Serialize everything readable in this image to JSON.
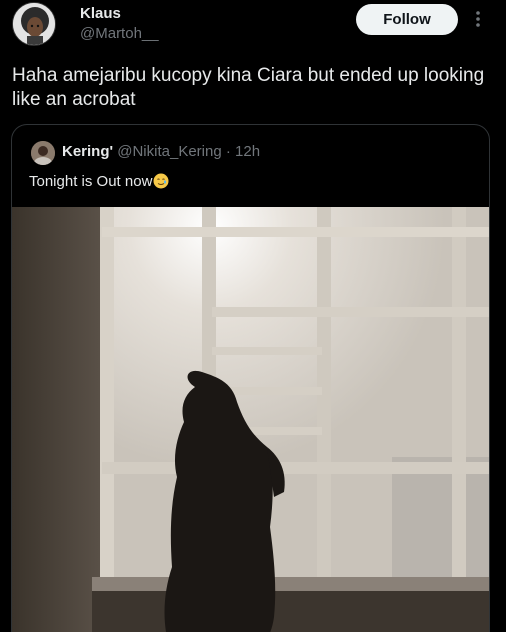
{
  "author": {
    "name": "Klaus",
    "handle": "@Martoh__"
  },
  "follow_label": "Follow",
  "tweet": {
    "text": "Haha amejaribu kucopy kina Ciara but ended up looking like an acrobat"
  },
  "quote": {
    "name": "Kering'",
    "handle": "@Nikita_Kering",
    "separator": " · ",
    "time": "12h",
    "text": "Tonight is Out now",
    "emoji": "smiling-face-with-tear"
  },
  "icons": {
    "more": "more-vertical-icon"
  },
  "colors": {
    "background": "#000000",
    "text": "#e7e9ea",
    "muted": "#71767b",
    "border": "#2f3336",
    "button_bg": "#eff3f4"
  }
}
